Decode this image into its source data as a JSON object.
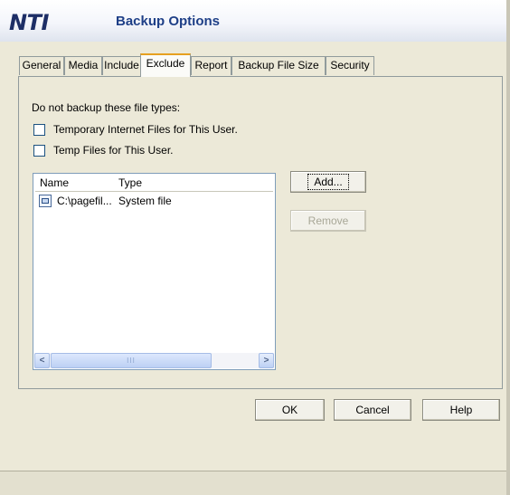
{
  "header": {
    "logo_text": "NTI",
    "title": "Backup Options"
  },
  "tabs": [
    {
      "label": "General",
      "selected": false
    },
    {
      "label": "Media",
      "selected": false
    },
    {
      "label": "Include",
      "selected": false
    },
    {
      "label": "Exclude",
      "selected": true
    },
    {
      "label": "Report",
      "selected": false
    },
    {
      "label": "Backup File Size",
      "selected": false
    },
    {
      "label": "Security",
      "selected": false
    }
  ],
  "exclude": {
    "intro": "Do not backup these file types:",
    "options": [
      {
        "label": "Temporary Internet Files for This User.",
        "checked": false
      },
      {
        "label": "Temp Files for This User.",
        "checked": false
      }
    ],
    "list": {
      "columns": [
        "Name",
        "Type"
      ],
      "rows": [
        {
          "name": "C:\\pagefil...",
          "type": "System file",
          "icon": "system-file-icon"
        }
      ]
    },
    "add_label": "Add...",
    "remove_label": "Remove"
  },
  "footer": {
    "ok_label": "OK",
    "cancel_label": "Cancel",
    "help_label": "Help"
  },
  "colors": {
    "title": "#1e3f87",
    "logo": "#1d2e66",
    "active_tab_accent": "#e6a020",
    "dialog_face": "#ece9d8"
  }
}
